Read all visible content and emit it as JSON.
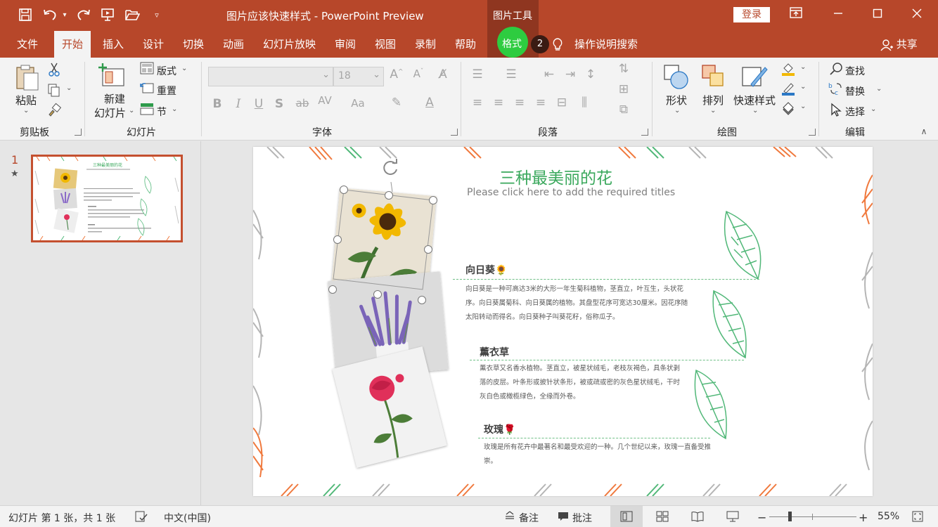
{
  "app": {
    "doc_title": "图片应该快速样式 - PowerPoint Preview",
    "tools_title": "图片工具",
    "login": "登录",
    "window_controls": [
      "restore-ribbon-icon",
      "minimize-icon",
      "maximize-icon",
      "close-icon"
    ]
  },
  "tabs": {
    "file": "文件",
    "home": "开始",
    "insert": "插入",
    "design": "设计",
    "transitions": "切换",
    "animations": "动画",
    "slideshow": "幻灯片放映",
    "review": "审阅",
    "view": "视图",
    "record": "录制",
    "help": "帮助",
    "format": "格式",
    "badge": "2",
    "tell_me": "操作说明搜索",
    "share": "共享"
  },
  "ribbon": {
    "clipboard": {
      "label": "剪贴板",
      "paste": "粘贴"
    },
    "slides": {
      "label": "幻灯片",
      "new_slide": "新建",
      "new_slide2": "幻灯片",
      "layout": "版式",
      "reset": "重置",
      "section": "节"
    },
    "font": {
      "label": "字体",
      "font_size": "18"
    },
    "paragraph": {
      "label": "段落"
    },
    "drawing": {
      "label": "绘图",
      "shapes": "形状",
      "arrange": "排列",
      "quick_styles": "快速样式"
    },
    "editing": {
      "label": "编辑",
      "find": "查找",
      "replace": "替换",
      "select": "选择"
    }
  },
  "thumbs": {
    "slide_number": "1"
  },
  "slide": {
    "title": "三种最美丽的花",
    "subtitle": "Please click here to add the required titles",
    "sections": [
      {
        "heading": "向日葵🌻",
        "body": "向日葵是一种可高达3米的大形一年生菊科植物，茎直立，叶互生，头状花序。向日葵属菊科、向日葵属的植物。其盘型花序可宽达30厘米。因花序随太阳转动而得名。向日葵种子叫葵花籽，俗称瓜子。"
      },
      {
        "heading": "薰衣草",
        "body": "薰衣草又名香水植物。茎直立，被星状绒毛，老枝灰褐色，具条状剥落的皮层。叶条形或披针状条形，被或疏或密的灰色星状绒毛，干时灰白色或橄榄绿色，全缘而外卷。"
      },
      {
        "heading": "玫瑰🌹",
        "body": "玫瑰是所有花卉中最著名和最受欢迎的一种。几个世纪以来，玫瑰一直备受推崇。"
      }
    ]
  },
  "status": {
    "slide_info": "幻灯片 第 1 张，共 1 张",
    "language": "中文(中国)",
    "notes": "备注",
    "comments": "批注",
    "zoom": "55%"
  },
  "colors": {
    "accent": "#b7472a",
    "tools_tab": "#8f3620",
    "format_highlight": "#2ecc40",
    "title_green": "#3aa85c",
    "leaf_orange": "#f0793d",
    "leaf_gray": "#b5b5b5",
    "leaf_green": "#52b879"
  }
}
